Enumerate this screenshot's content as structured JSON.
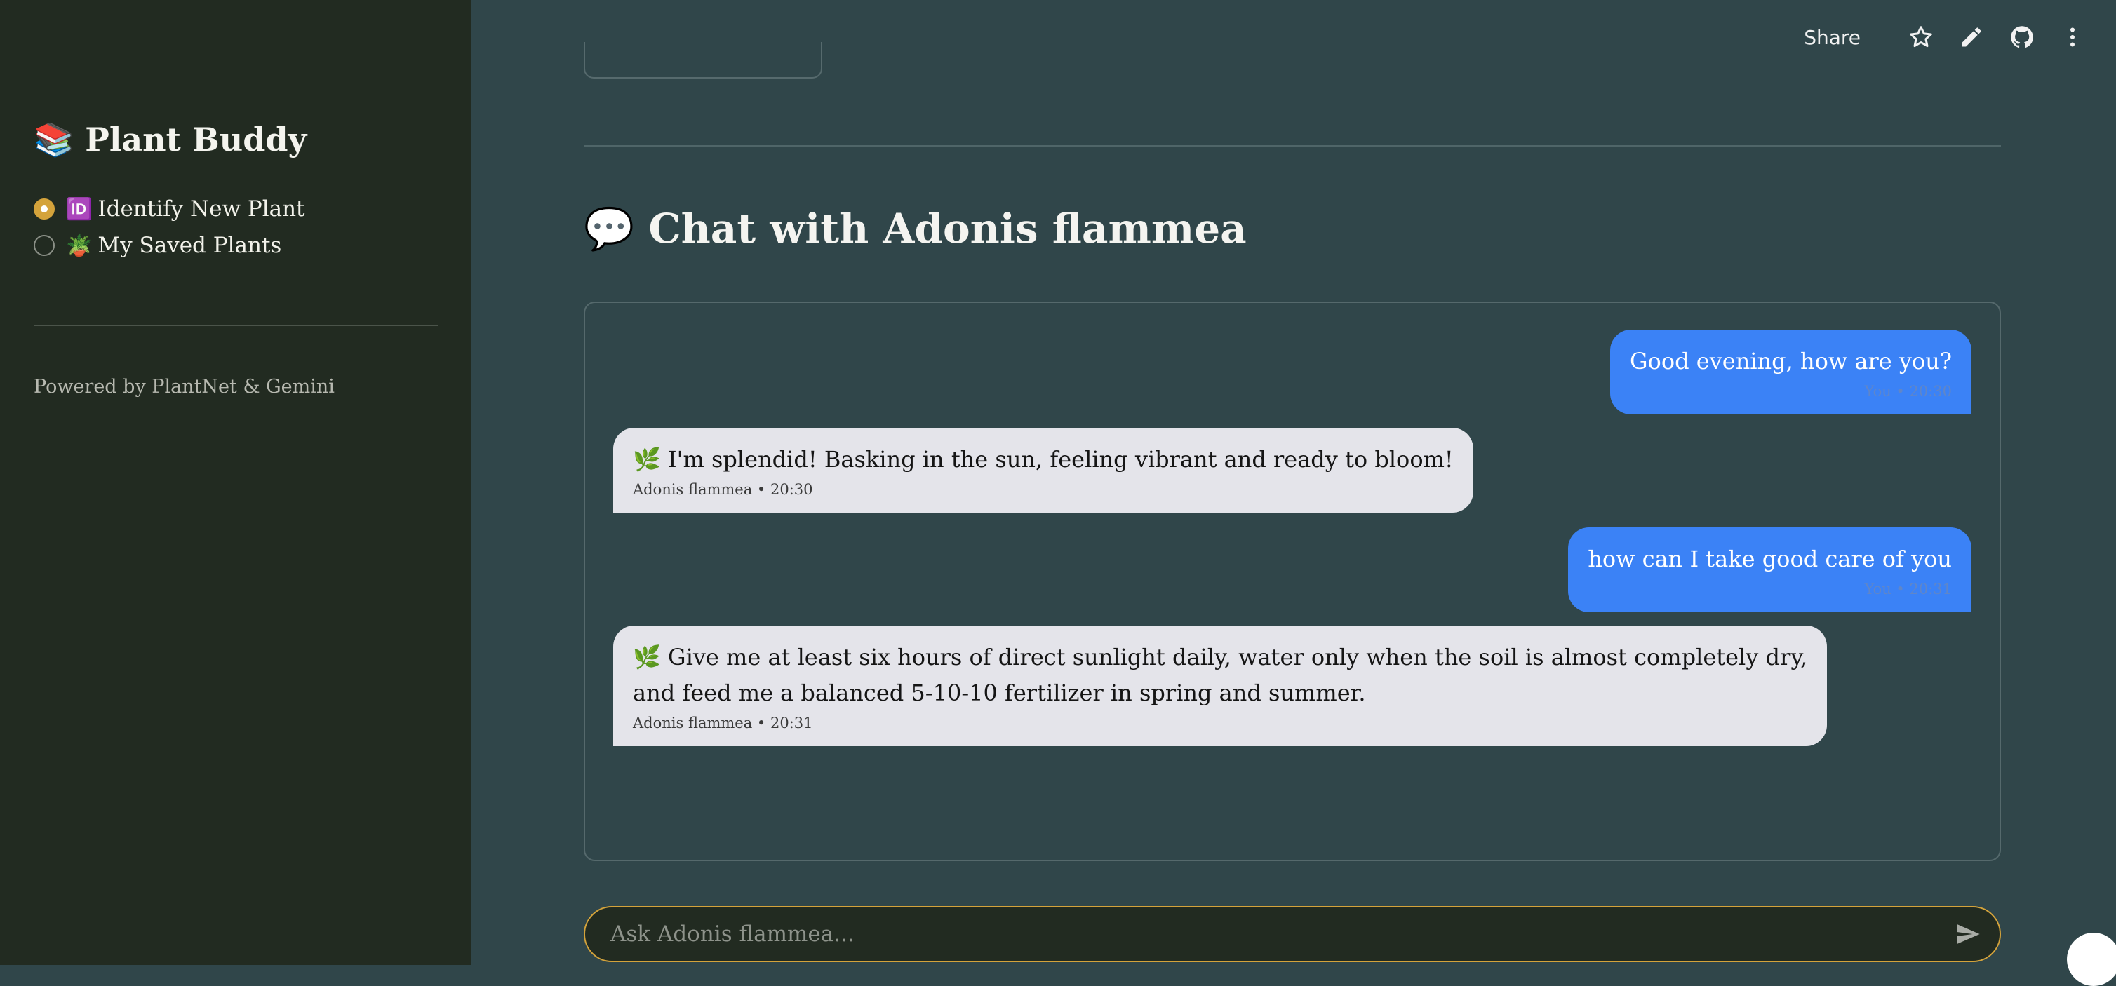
{
  "sidebar": {
    "title_icon": "📚",
    "title": "Plant Buddy",
    "options": [
      {
        "emoji": "🆔",
        "label": "Identify New Plant",
        "selected": true
      },
      {
        "emoji": "🪴",
        "label": "My Saved Plants",
        "selected": false
      }
    ],
    "footer": "Powered by PlantNet & Gemini"
  },
  "toolbar": {
    "share_label": "Share",
    "icons": [
      "star-icon",
      "pencil-icon",
      "github-icon",
      "more-vertical-icon"
    ]
  },
  "chat": {
    "heading_icon": "💬",
    "heading": "Chat with Adonis flammea",
    "messages": [
      {
        "role": "user",
        "text": "Good evening, how are you?",
        "meta": "You • 20:30"
      },
      {
        "role": "bot",
        "icon": "🌿",
        "text": "I'm splendid! Basking in the sun, feeling vibrant and ready to bloom!",
        "meta": "Adonis flammea • 20:30"
      },
      {
        "role": "user",
        "text": "how can I take good care of you",
        "meta": "You • 20:31"
      },
      {
        "role": "bot",
        "icon": "🌿",
        "text_line1": "Give me at least six hours of direct sunlight daily, water only when the soil is almost completely dry,",
        "text_line2": "and feed me a balanced 5-10-10 fertilizer in spring and summer.",
        "meta": "Adonis flammea • 20:31"
      }
    ],
    "input_placeholder": "Ask Adonis flammea...",
    "input_value": ""
  },
  "colors": {
    "sidebar_bg": "#222b21",
    "main_bg": "#30464a",
    "accent": "#d4a33b",
    "user_bubble": "#3b82f6",
    "bot_bubble": "#e4e4ea"
  }
}
